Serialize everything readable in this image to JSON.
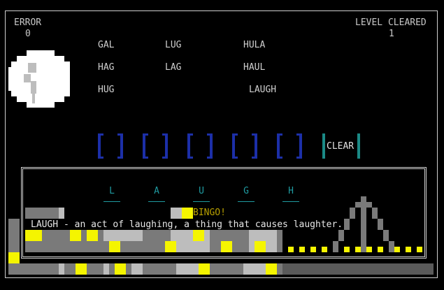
{
  "hud": {
    "error_label": "ERROR",
    "error_value": "0",
    "level_label": "LEVEL CLEARED",
    "level_value": "1"
  },
  "words": [
    "GAL",
    "LUG",
    "HULA",
    "HAG",
    "LAG",
    "HAUL",
    "HUG",
    "LAUGH"
  ],
  "slots": [
    "",
    "",
    "",
    "",
    "",
    ""
  ],
  "clear_label": "CLEAR",
  "answer_letters": [
    "L",
    "A",
    "U",
    "G",
    "H"
  ],
  "bingo_text": "BINGO!",
  "definition": "LAUGH - an act of laughing, a thing that causes laughter.",
  "colors": {
    "slot_bracket": "#1c2fa8",
    "clear_bracket": "#1b8a86",
    "answer_letter": "#1f9aa0",
    "bingo": "#b8a000",
    "highlight": "#f5f500"
  }
}
